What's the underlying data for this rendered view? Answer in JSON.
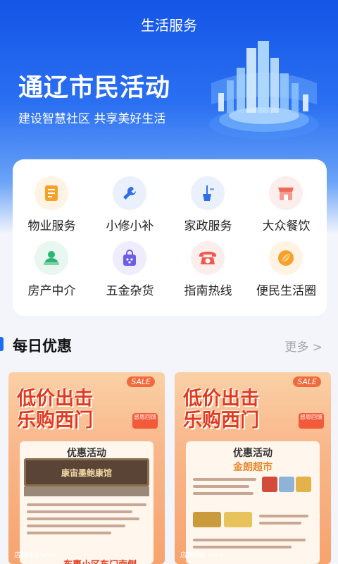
{
  "header": {
    "title": "生活服务"
  },
  "hero": {
    "title": "通辽市民活动",
    "subtitle": "建设智慧社区 共享美好生活"
  },
  "services": [
    {
      "label": "物业服务",
      "icon": "notebook-icon",
      "color": "#f5a12a",
      "bg": "#fff3e3"
    },
    {
      "label": "小修小补",
      "icon": "wrench-icon",
      "color": "#2f6fe8",
      "bg": "#eaf1fd"
    },
    {
      "label": "家政服务",
      "icon": "mop-bucket-icon",
      "color": "#2f6fe8",
      "bg": "#eaf1fd"
    },
    {
      "label": "大众餐饮",
      "icon": "storefront-icon",
      "color": "#f06a5a",
      "bg": "#fdeeee"
    },
    {
      "label": "房产中介",
      "icon": "agent-desk-icon",
      "color": "#2bb673",
      "bg": "#e8f7ef"
    },
    {
      "label": "五金杂货",
      "icon": "shopping-bag-icon",
      "color": "#6b5fe8",
      "bg": "#efedfd"
    },
    {
      "label": "指南热线",
      "icon": "telephone-icon",
      "color": "#f0584c",
      "bg": "#fdeeee"
    },
    {
      "label": "便民生活圈",
      "icon": "leaf-circle-icon",
      "color": "#f5a12a",
      "bg": "#fff3e3"
    }
  ],
  "section": {
    "title": "每日优惠",
    "more": "更多 >"
  },
  "promos": [
    {
      "title_line1": "低价出击",
      "title_line2": "乐购西门",
      "sale": "SALE",
      "tag": "感恩回馈",
      "card_heading": "优惠活动",
      "card_subheading": "",
      "shop_sign": "康宙墨鲍康馆",
      "address_label": "店铺地址 >>>",
      "address": "东惠小区东门南侧"
    },
    {
      "title_line1": "低价出击",
      "title_line2": "乐购西门",
      "sale": "SALE",
      "tag": "感恩回馈",
      "card_heading": "优惠活动",
      "card_subheading": "金朗超市",
      "shop_sign": "",
      "address_label": "店铺地址 >>>",
      "address": ""
    }
  ]
}
